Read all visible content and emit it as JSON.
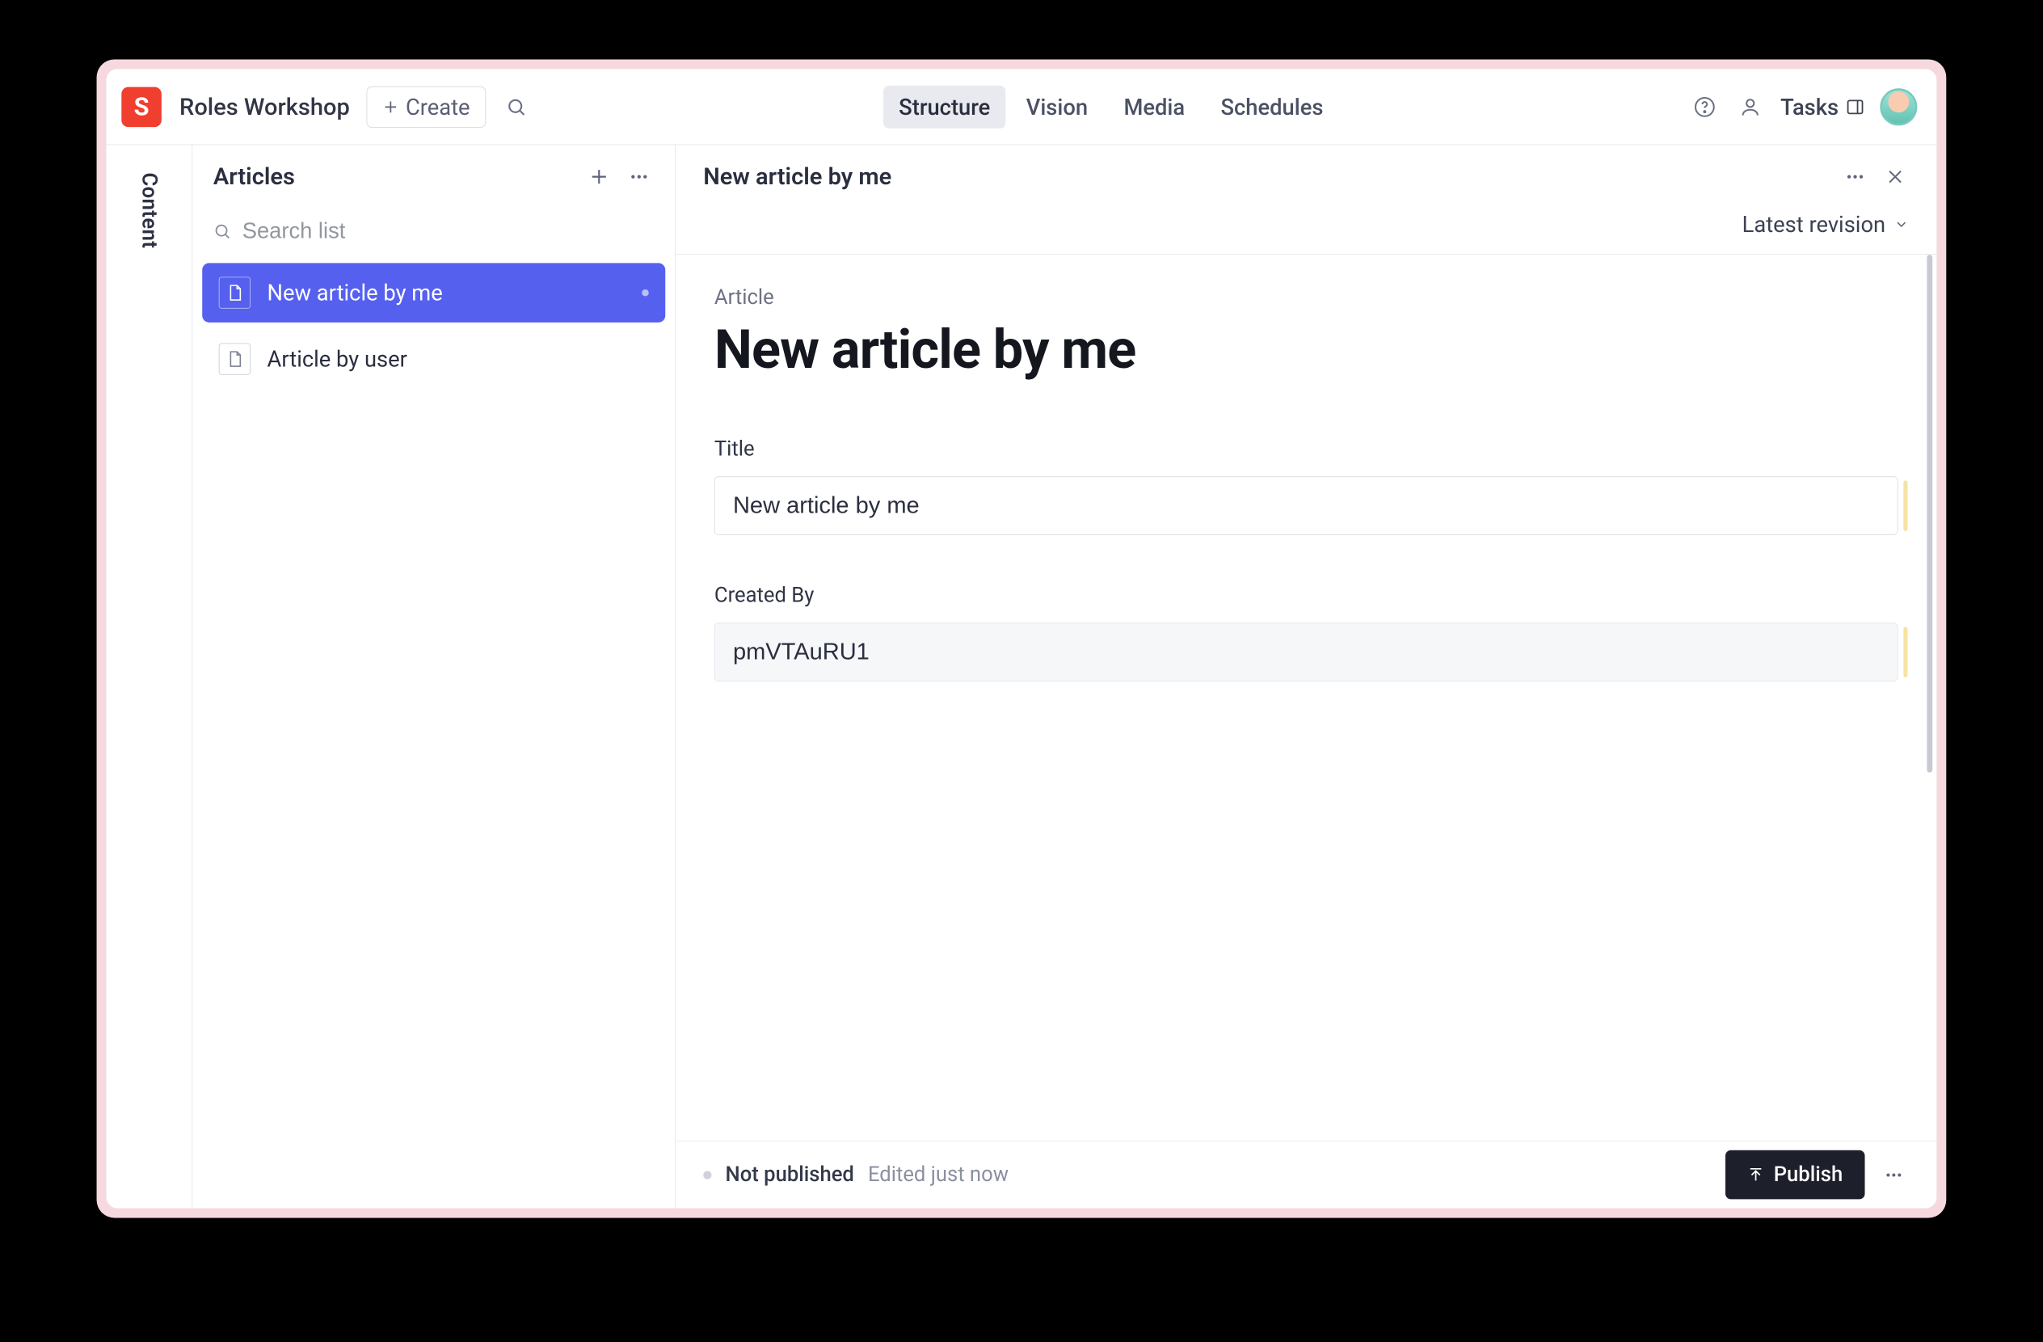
{
  "brand_letter": "S",
  "workspace_name": "Roles Workshop",
  "create_label": "Create",
  "nav_tabs": [
    "Structure",
    "Vision",
    "Media",
    "Schedules"
  ],
  "nav_active_index": 0,
  "tasks_label": "Tasks",
  "left_rail_label": "Content",
  "list": {
    "title": "Articles",
    "search_placeholder": "Search list",
    "items": [
      {
        "label": "New article by me",
        "selected": true,
        "has_status_dot": true
      },
      {
        "label": "Article by user",
        "selected": false,
        "has_status_dot": false
      }
    ]
  },
  "doc": {
    "crumb_title": "New article by me",
    "revision_label": "Latest revision",
    "type_label": "Article",
    "heading": "New article by me",
    "fields": {
      "title": {
        "label": "Title",
        "value": "New article by me"
      },
      "created_by": {
        "label": "Created By",
        "value": "pmVTAuRU1"
      }
    },
    "footer": {
      "status": "Not published",
      "edited": "Edited just now",
      "publish_label": "Publish"
    }
  }
}
